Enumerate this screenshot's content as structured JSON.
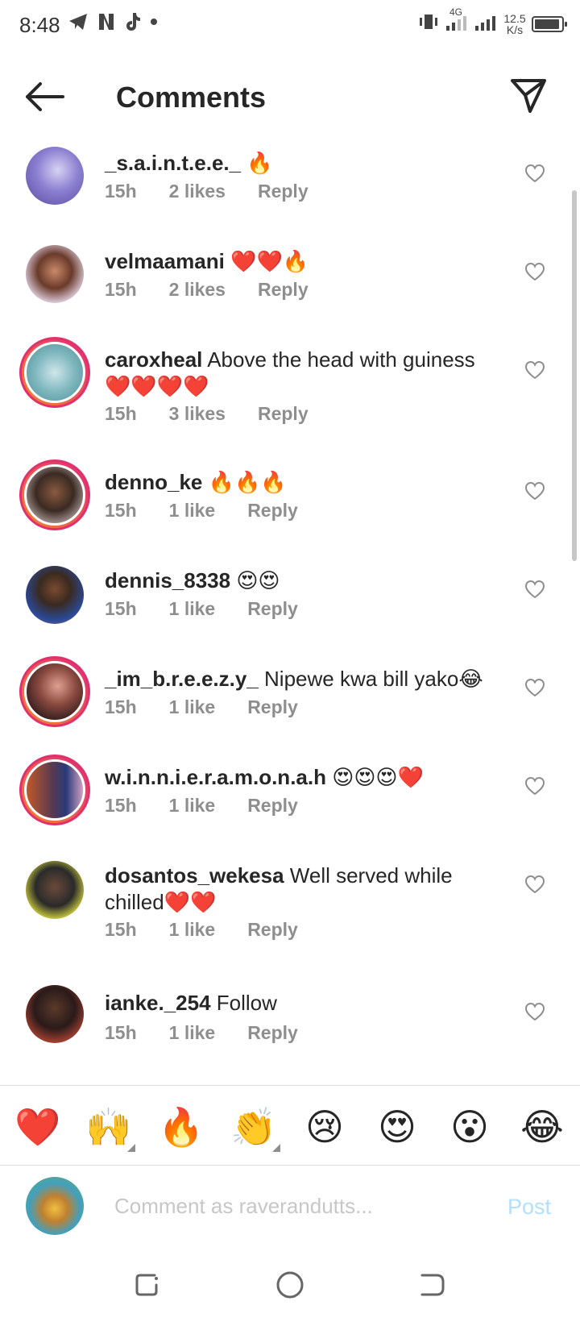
{
  "status_bar": {
    "time": "8:48",
    "network_label": "4G",
    "speed_value": "12.5",
    "speed_unit": "K/s"
  },
  "header": {
    "title": "Comments"
  },
  "comments": [
    {
      "username": "_s.a.i.n.t.e.e._",
      "text": " 🔥",
      "time": "15h",
      "likes": "2 likes",
      "reply": "Reply"
    },
    {
      "username": "velmaamani",
      "text": " ❤️❤️🔥",
      "time": "15h",
      "likes": "2 likes",
      "reply": "Reply"
    },
    {
      "username": "caroxheal",
      "text": " Above the head with guiness ❤️❤️❤️❤️",
      "time": "15h",
      "likes": "3 likes",
      "reply": "Reply"
    },
    {
      "username": "denno_ke",
      "text": " 🔥🔥🔥",
      "time": "15h",
      "likes": "1 like",
      "reply": "Reply"
    },
    {
      "username": "dennis_8338",
      "text": " 😍😍",
      "time": "15h",
      "likes": "1 like",
      "reply": "Reply"
    },
    {
      "username": "_im_b.r.e.e.z.y_",
      "text": " Nipewe kwa bill yako😂",
      "time": "15h",
      "likes": "1 like",
      "reply": "Reply"
    },
    {
      "username": "w.i.n.n.i.e.r.a.m.o.n.a.h",
      "text": " 😍😍😍❤️",
      "time": "15h",
      "likes": "1 like",
      "reply": "Reply"
    },
    {
      "username": "dosantos_wekesa",
      "text": " Well served while chilled❤️❤️",
      "time": "15h",
      "likes": "1 like",
      "reply": "Reply"
    },
    {
      "username": "ianke._254",
      "text": " Follow",
      "time": "15h",
      "likes": "1 like",
      "reply": "Reply"
    }
  ],
  "emoji_bar": [
    "❤️",
    "🙌",
    "🔥",
    "👏",
    "😢",
    "😍",
    "😮",
    "😂"
  ],
  "input": {
    "placeholder": "Comment as raverandutts...",
    "post_label": "Post"
  },
  "colors": {
    "text": "#262626",
    "meta": "#8e8e8e",
    "story_ring": "#e1306c",
    "post_disabled": "#b2dffc"
  }
}
